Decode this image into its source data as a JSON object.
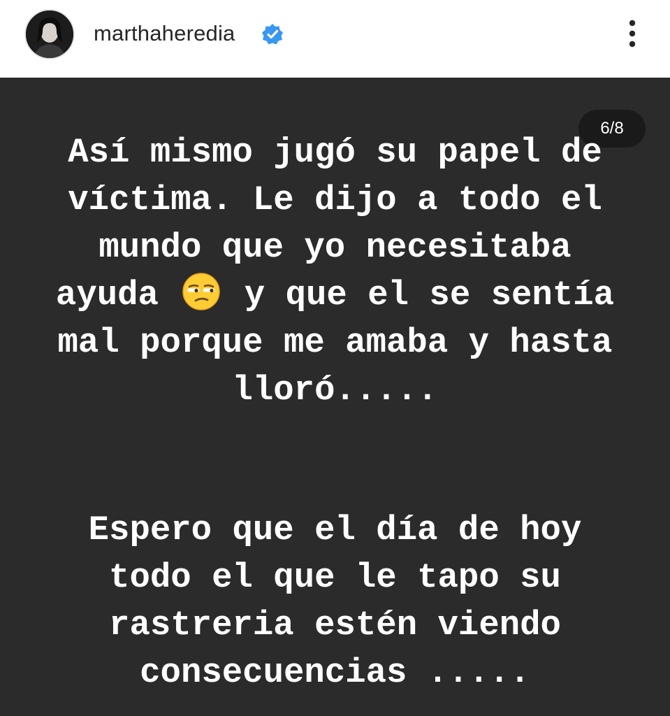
{
  "header": {
    "username": "marthaheredia",
    "avatar_icon": "profile-avatar",
    "verified_icon": "verified-badge-icon",
    "more_icon": "more-options-icon",
    "verified_color": "#3897f0"
  },
  "story": {
    "counter": "6/8",
    "background_color": "#2b2b2b",
    "paragraph1": {
      "line1": "Así mismo jugó su papel de",
      "line2": "víctima. Le dijo a todo el",
      "line3": "mundo que yo necesitaba",
      "line4_a": "ayuda",
      "line4_emoji": "unamused-face-emoji",
      "line4_b": "y que el se sentía",
      "line5": "mal porque me amaba y hasta",
      "line6": "lloró....."
    },
    "paragraph2": {
      "line1": "Espero que el día de hoy",
      "line2": "todo el que le tapo su",
      "line3": "rastreria estén viendo",
      "line4": "consecuencias ....."
    }
  }
}
